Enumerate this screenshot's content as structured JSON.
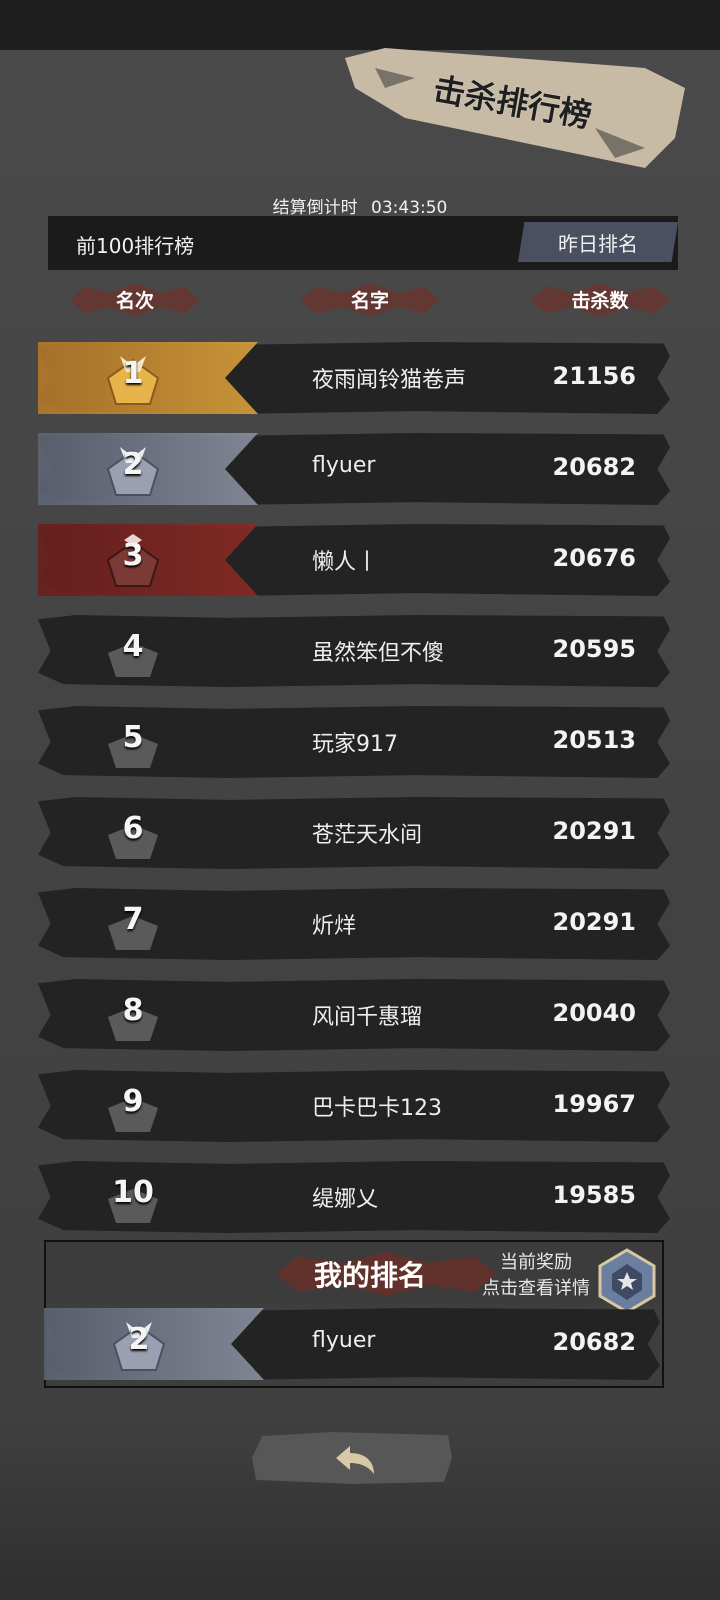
{
  "title": "击杀排行榜",
  "countdown": {
    "label": "结算倒计时",
    "time": "03:43:50"
  },
  "top100_label": "前100排行榜",
  "yesterday_button": "昨日排名",
  "columns": {
    "rank": "名次",
    "name": "名字",
    "kills": "击杀数"
  },
  "rows": [
    {
      "rank": "1",
      "name": "夜雨闻铃猫卷声",
      "kills": "21156"
    },
    {
      "rank": "2",
      "name": "flyuer",
      "kills": "20682"
    },
    {
      "rank": "3",
      "name": "懒人丨",
      "kills": "20676"
    },
    {
      "rank": "4",
      "name": "虽然笨但不傻",
      "kills": "20595"
    },
    {
      "rank": "5",
      "name": "玩家917",
      "kills": "20513"
    },
    {
      "rank": "6",
      "name": "苍茫天水间",
      "kills": "20291"
    },
    {
      "rank": "7",
      "name": "炘烊",
      "kills": "20291"
    },
    {
      "rank": "8",
      "name": "风间千惠瑠",
      "kills": "20040"
    },
    {
      "rank": "9",
      "name": "巴卡巴卡123",
      "kills": "19967"
    },
    {
      "rank": "10",
      "name": "缇娜乂",
      "kills": "19585"
    }
  ],
  "my_rank": {
    "title": "我的排名",
    "reward_line1": "当前奖励",
    "reward_line2": "点击查看详情",
    "rank": "2",
    "name": "flyuer",
    "kills": "20682"
  },
  "colors": {
    "gold": "#d9a03a",
    "silver": "#8a90a0",
    "bronze": "#8a2a24",
    "splash_red": "#7a2a20"
  },
  "icons": {
    "back": "back-arrow-icon",
    "reward": "reward-badge-icon"
  }
}
